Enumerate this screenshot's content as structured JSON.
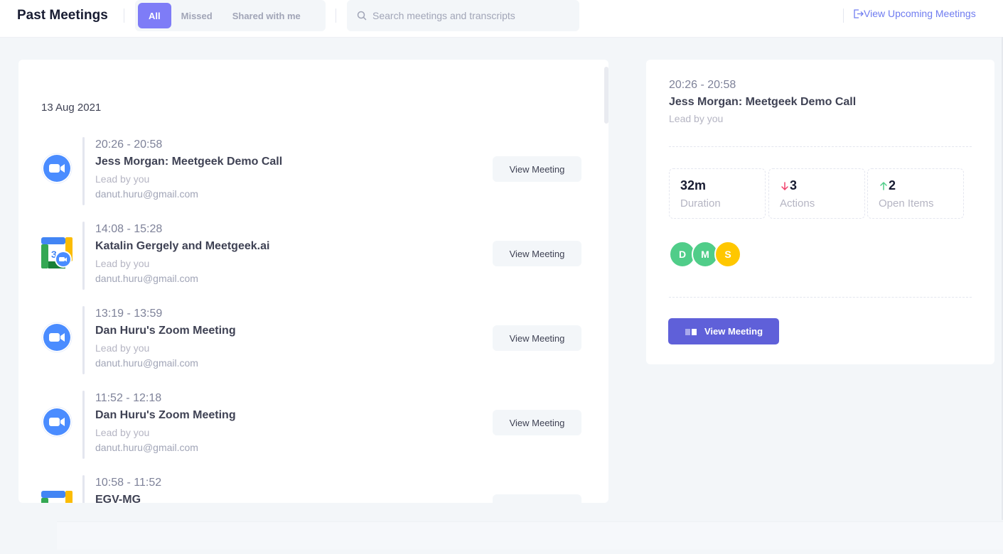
{
  "header": {
    "title": "Past Meetings",
    "tabs": [
      "All",
      "Missed",
      "Shared with me"
    ],
    "search_placeholder": "Search meetings and transcripts",
    "upcoming_link": "View Upcoming Meetings"
  },
  "list": {
    "date": "13 Aug 2021",
    "button_label": "View Meeting",
    "meetings": [
      {
        "time": "20:26 - 20:58",
        "title": "Jess Morgan: Meetgeek Demo Call",
        "lead": "Lead by you",
        "email": "danut.huru@gmail.com",
        "icon": "zoom-icon"
      },
      {
        "time": "14:08 - 15:28",
        "title": "Katalin Gergely and Meetgeek.ai",
        "lead": "Lead by you",
        "email": "danut.huru@gmail.com",
        "icon": "google-calendar-icon"
      },
      {
        "time": "13:19 - 13:59",
        "title": "Dan Huru's Zoom Meeting",
        "lead": "Lead by you",
        "email": "danut.huru@gmail.com",
        "icon": "zoom-icon"
      },
      {
        "time": "11:52 - 12:18",
        "title": "Dan Huru's Zoom Meeting",
        "lead": "Lead by you",
        "email": "danut.huru@gmail.com",
        "icon": "zoom-icon"
      },
      {
        "time": "10:58 - 11:52",
        "title": "EGV-MG",
        "lead": "",
        "email": "",
        "icon": "google-calendar-icon"
      }
    ]
  },
  "detail": {
    "time": "20:26 - 20:58",
    "title": "Jess Morgan: Meetgeek Demo Call",
    "lead": "Lead by you",
    "stats": [
      {
        "value": "32m",
        "label": "Duration",
        "trend": "none"
      },
      {
        "value": "3",
        "label": "Actions",
        "trend": "down"
      },
      {
        "value": "2",
        "label": "Open Items",
        "trend": "up"
      }
    ],
    "participants": [
      {
        "initial": "D",
        "color": "#50cd89"
      },
      {
        "initial": "M",
        "color": "#50cd89"
      },
      {
        "initial": "S",
        "color": "#ffc700"
      }
    ],
    "button_label": "View Meeting"
  },
  "colors": {
    "accent": "#7e7cf7",
    "primary_button": "#5f60d9",
    "zoom_blue": "#4a8cff",
    "trend_down": "#f1416c",
    "trend_up": "#50cd89"
  }
}
